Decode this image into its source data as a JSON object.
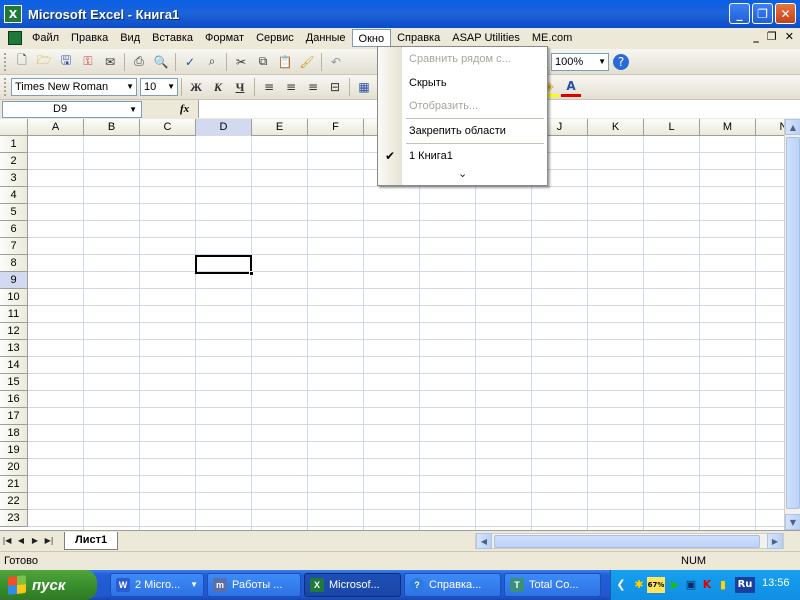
{
  "window": {
    "title": "Microsoft Excel - Книга1",
    "minimize": "_",
    "restore": "❐",
    "close": "✕"
  },
  "menubar": {
    "items": [
      "Файл",
      "Правка",
      "Вид",
      "Вставка",
      "Формат",
      "Сервис",
      "Данные",
      "Окно",
      "Справка",
      "ASAP Utilities",
      "ME.com"
    ],
    "active_index": 7,
    "doc_minimize": "_",
    "doc_restore": "❐",
    "doc_close": "✕"
  },
  "toolbar": {
    "zoom": "100%",
    "font_name": "Times New Roman",
    "font_size": "10",
    "bold": "Ж",
    "italic": "К",
    "underline": "Ч"
  },
  "formula_bar": {
    "name_box": "D9",
    "fx": "fx",
    "formula": ""
  },
  "grid": {
    "columns": [
      "A",
      "B",
      "C",
      "D",
      "E",
      "F",
      "G",
      "H",
      "I",
      "J",
      "K",
      "L",
      "M",
      "N"
    ],
    "rows": [
      "1",
      "2",
      "3",
      "4",
      "5",
      "6",
      "7",
      "8",
      "9",
      "10",
      "11",
      "12",
      "13",
      "14",
      "15",
      "16",
      "17",
      "18",
      "19",
      "20",
      "21",
      "22",
      "23"
    ],
    "selected_column": "D",
    "selected_row": "9"
  },
  "window_menu": {
    "items": [
      {
        "label": "Сравнить рядом с...",
        "enabled": false
      },
      {
        "label": "Скрыть",
        "enabled": true
      },
      {
        "label": "Отобразить...",
        "enabled": false
      },
      {
        "label": "Закрепить области",
        "enabled": true
      },
      {
        "label": "1 Книга1",
        "enabled": true,
        "checked": true
      }
    ],
    "expand": "⌄"
  },
  "sheets": {
    "tabs": [
      "Лист1"
    ],
    "active": "Лист1"
  },
  "status": {
    "text": "Готово",
    "num": "NUM"
  },
  "taskbar": {
    "start_label": "пуск",
    "buttons": [
      {
        "label": "2 Micro...",
        "icon": "W"
      },
      {
        "label": "Работы ...",
        "icon": "m"
      },
      {
        "label": "Microsof...",
        "icon": "X"
      },
      {
        "label": "Справка...",
        "icon": "?"
      },
      {
        "label": "Total Co...",
        "icon": "T"
      }
    ],
    "tray_lang": "Ru",
    "clock": "13:56",
    "battery": "67%"
  }
}
